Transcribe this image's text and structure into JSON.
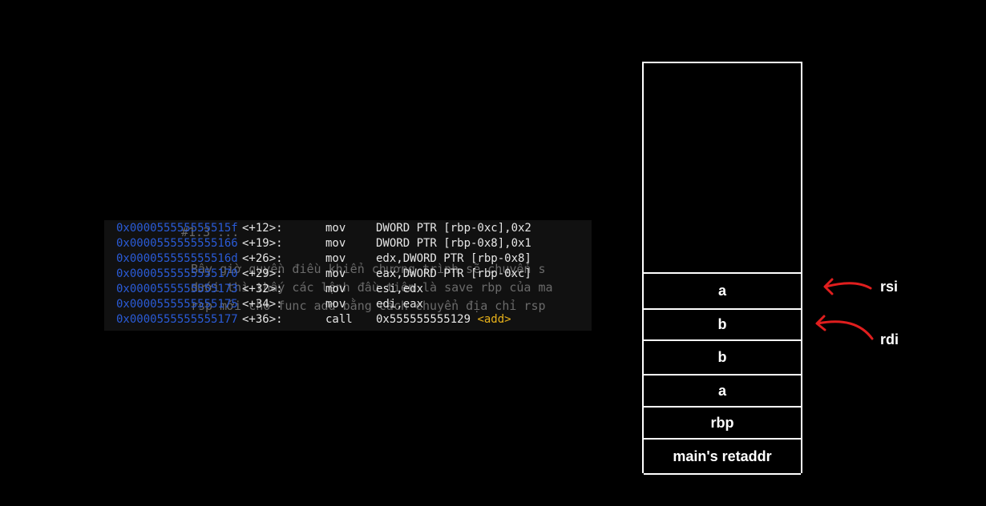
{
  "background_text": [
    "#1.3 ...",
    "Bây giờ quyền điều khiển chương trình sẽ chuyển s",
    "dưới thì thấy các lệnh đầu tiên là save rbp của ma",
    "rsp mới cho func add bằng cách chuyển địa chỉ rsp"
  ],
  "asm_lines": [
    {
      "addr": "0x000055555555515f",
      "offset": "<+12>:",
      "mnemonic": "mov",
      "operands": "DWORD PTR [rbp-0xc],0x2",
      "symbol": ""
    },
    {
      "addr": "0x0000555555555166",
      "offset": "<+19>:",
      "mnemonic": "mov",
      "operands": "DWORD PTR [rbp-0x8],0x1",
      "symbol": ""
    },
    {
      "addr": "0x000055555555516d",
      "offset": "<+26>:",
      "mnemonic": "mov",
      "operands": "edx,DWORD PTR [rbp-0x8]",
      "symbol": ""
    },
    {
      "addr": "0x0000555555555170",
      "offset": "<+29>:",
      "mnemonic": "mov",
      "operands": "eax,DWORD PTR [rbp-0xc]",
      "symbol": ""
    },
    {
      "addr": "0x0000555555555173",
      "offset": "<+32>:",
      "mnemonic": "mov",
      "operands": "esi,edx",
      "symbol": ""
    },
    {
      "addr": "0x0000555555555175",
      "offset": "<+34>:",
      "mnemonic": "mov",
      "operands": "edi,eax",
      "symbol": ""
    },
    {
      "addr": "0x0000555555555177",
      "offset": "<+36>:",
      "mnemonic": "call",
      "operands": "0x555555555129 ",
      "symbol": "<add>"
    }
  ],
  "stack": {
    "slots": [
      "a",
      "b",
      "b",
      "a",
      "rbp",
      "main's retaddr"
    ]
  },
  "registers": [
    {
      "name": "rsi",
      "points_to": "a"
    },
    {
      "name": "rdi",
      "points_to": "b"
    }
  ],
  "colors": {
    "address": "#2a5bd7",
    "symbol": "#e8b21a",
    "arrow": "#e01e1e",
    "box_border": "#ffffff"
  }
}
